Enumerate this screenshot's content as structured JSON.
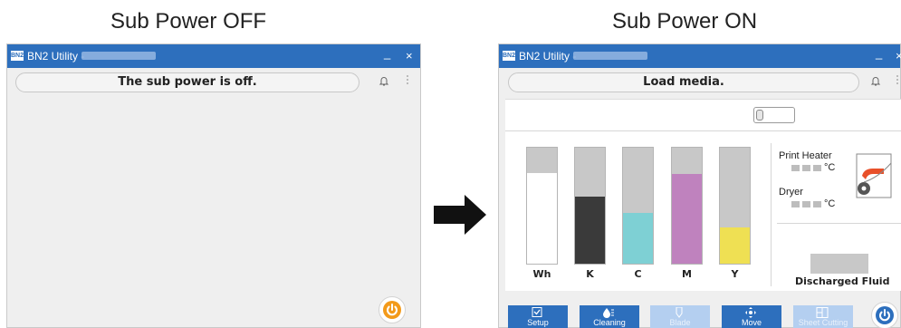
{
  "captions": {
    "off": "Sub Power OFF",
    "on": "Sub Power ON"
  },
  "app": {
    "logo": "BN2",
    "title": "BN2 Utility -",
    "minimize": "_",
    "close": "×"
  },
  "off_window": {
    "status": "The sub power is off."
  },
  "on_window": {
    "status": "Load media.",
    "inks": [
      {
        "label": "Wh",
        "level": 0.78,
        "color": "#ffffff"
      },
      {
        "label": "K",
        "level": 0.58,
        "color": "#3a3a3a"
      },
      {
        "label": "C",
        "level": 0.44,
        "color": "#7ed0d4"
      },
      {
        "label": "M",
        "level": 0.77,
        "color": "#bf82be"
      },
      {
        "label": "Y",
        "level": 0.31,
        "color": "#efe053"
      }
    ],
    "print_heater": {
      "label": "Print Heater",
      "unit": "°C"
    },
    "dryer": {
      "label": "Dryer",
      "unit": "°C"
    },
    "discharged_fluid": {
      "label": "Discharged Fluid"
    },
    "toolbar": [
      {
        "label": "Setup",
        "icon": "setup-icon",
        "enabled": true
      },
      {
        "label": "Cleaning",
        "icon": "cleaning-icon",
        "enabled": true
      },
      {
        "label": "Blade",
        "icon": "blade-icon",
        "enabled": false
      },
      {
        "label": "Move",
        "icon": "move-icon",
        "enabled": true
      },
      {
        "label": "Sheet Cutting",
        "icon": "sheet-cutting-icon",
        "enabled": false
      }
    ]
  },
  "colors": {
    "titlebar": "#2d6fbd",
    "power_accent": "#f39a1a",
    "heater_accent": "#e8502a"
  }
}
